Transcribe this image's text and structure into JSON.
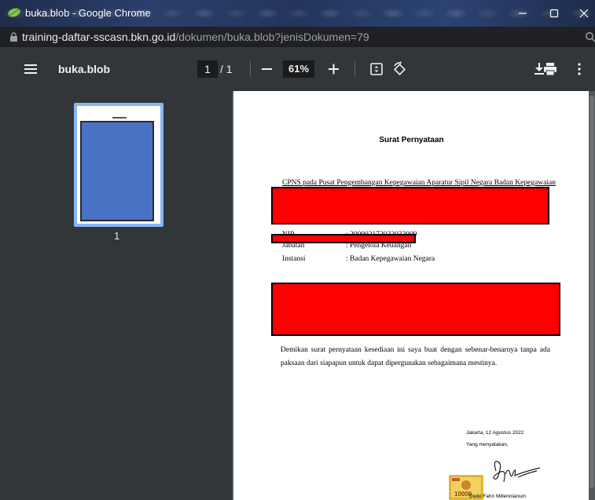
{
  "window": {
    "title": "buka.blob - Google Chrome",
    "favicon": "leaf-icon",
    "controls": [
      "minimize-icon",
      "maximize-icon",
      "close-icon"
    ]
  },
  "address": {
    "host": "training-daftar-sscasn.bkn.go.id",
    "path": "/dokumen/buka.blob?jenisDokumen=79"
  },
  "toolbar": {
    "doc_name": "buka.blob",
    "page_current": "1",
    "page_total": "/ 1",
    "zoom": "61%",
    "icons": [
      "menu-icon",
      "zoom-out-icon",
      "zoom-in-icon",
      "fit-page-icon",
      "rotate-icon",
      "download-icon",
      "print-icon",
      "more-icon"
    ]
  },
  "sidebar": {
    "thumbnail_page_number": "1"
  },
  "document": {
    "title": "Surat Pernyataan",
    "line1": "CPNS pada Pusat Pengembangan Kepegawaian Aparatur Sipil Negara Badan Kepegawaian",
    "nip_label": "NIP",
    "nip_value": ": 200002172022032009",
    "jabatan_label": "Jabatan",
    "jabatan_value": ": Pengelola Keuangan",
    "instansi_label": "Instansi",
    "instansi_value": ": Badan Kepegawaian Negara",
    "paragraph": "Demikan surat pernyataan kesediaan ini saya buat dengan sebenar-benarnya tanpa ada paksaan dari siapapun untuk dapat dipergunakan sebagaimana mestinya.",
    "place_date": "Jakarta, 12 Agustus 2022",
    "closing": "Yang menyatakan,",
    "stamp_value": "10000",
    "signer_name": "Dwiki Fahri Millennianum"
  },
  "colors": {
    "redaction": "#ff0000",
    "toolbar_bg": "#323639",
    "viewer_bg": "#525659",
    "thumb_highlight": "#8ab4f8"
  }
}
